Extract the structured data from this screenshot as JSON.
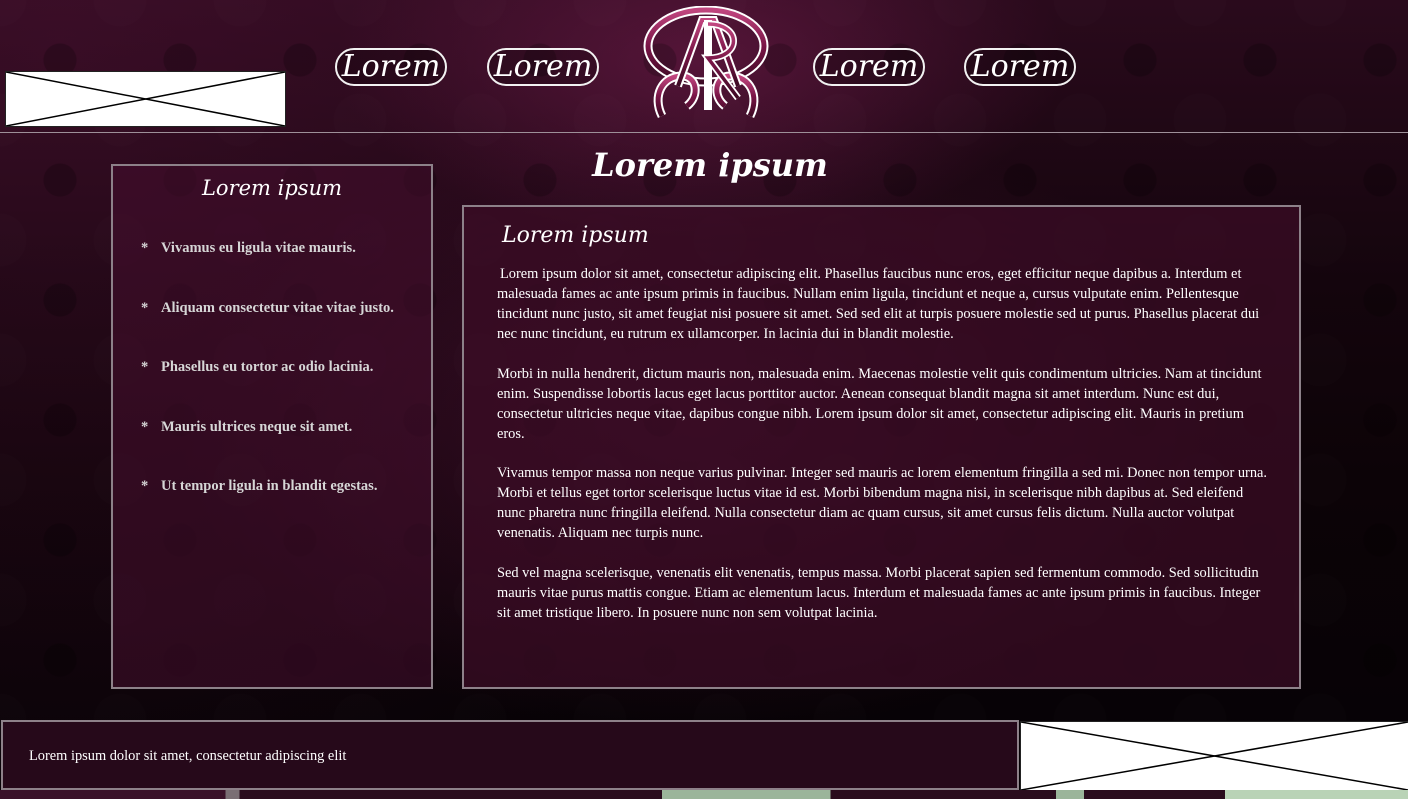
{
  "header": {
    "nav": [
      "Lorem",
      "Lorem",
      "Lorem",
      "Lorem"
    ],
    "logo_letters": "AR"
  },
  "page": {
    "heading": "Lorem ipsum"
  },
  "sidebar": {
    "title": "Lorem ipsum",
    "bullet": "*",
    "items": [
      "Vivamus eu ligula vitae mauris.",
      "Aliquam consectetur vitae vitae justo.",
      "Phasellus eu tortor ac odio lacinia.",
      "Mauris ultrices neque sit amet.",
      "Ut tempor ligula in blandit egestas."
    ]
  },
  "main": {
    "title": "Lorem ipsum",
    "paragraphs": [
      "Lorem ipsum dolor sit amet, consectetur adipiscing elit. Phasellus faucibus nunc eros, eget efficitur neque dapibus a. Interdum et malesuada fames ac ante ipsum primis in faucibus. Nullam enim ligula, tincidunt et neque a, cursus vulputate enim. Pellentesque tincidunt nunc justo, sit amet feugiat nisi posuere sit amet. Sed sed elit at turpis posuere molestie sed ut purus. Phasellus placerat dui nec nunc tincidunt, eu rutrum ex ullamcorper. In lacinia dui in blandit molestie.",
      "Morbi in nulla hendrerit, dictum mauris non, malesuada enim. Maecenas molestie velit quis condimentum ultricies. Nam at tincidunt enim. Suspendisse lobortis lacus eget lacus porttitor auctor. Aenean consequat blandit magna sit amet interdum. Nunc est dui, consectetur ultricies neque vitae, dapibus congue nibh. Lorem ipsum dolor sit amet, consectetur adipiscing elit. Mauris in pretium eros.",
      "Vivamus tempor massa non neque varius pulvinar. Integer sed mauris ac lorem elementum fringilla a sed mi. Donec non tempor urna. Morbi et tellus eget tortor scelerisque luctus vitae id est. Morbi bibendum magna nisi, in scelerisque nibh dapibus at. Sed eleifend nunc pharetra nunc fringilla eleifend. Nulla consectetur diam ac quam cursus, sit amet cursus felis dictum. Nulla auctor volutpat venenatis. Aliquam nec turpis nunc.",
      "Sed vel magna scelerisque, venenatis elit venenatis, tempus massa. Morbi placerat sapien sed fermentum commodo. Sed sollicitudin mauris vitae purus mattis congue. Etiam ac elementum lacus. Interdum et malesuada fames ac ante ipsum primis in faucibus. Integer sit amet tristique libero. In posuere nunc non sem volutpat lacinia."
    ]
  },
  "footer": {
    "text": "Lorem ipsum dolor sit amet, consectetur adipiscing elit"
  },
  "colors": {
    "panel_border": "#8d8189",
    "panel_bg": "#3c0c26",
    "accent": "#8a1e55"
  }
}
